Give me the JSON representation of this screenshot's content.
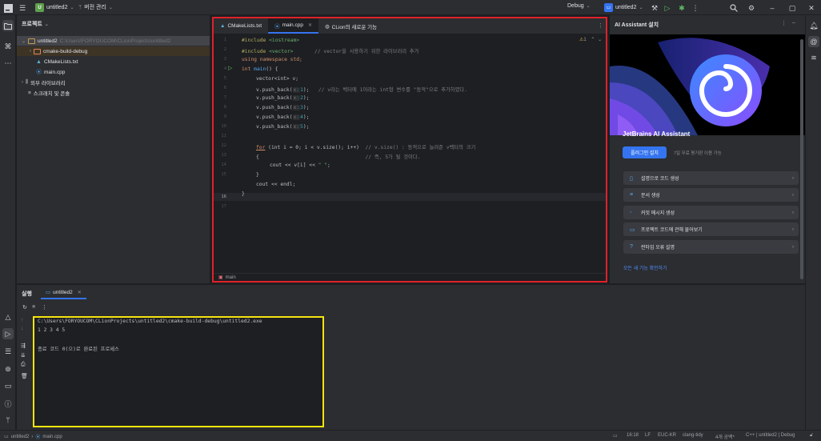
{
  "titlebar": {
    "project": "untitled2",
    "project_badge": "U",
    "vcs": "버전 관리",
    "config": "Debug",
    "run_target": "untitled2"
  },
  "project_panel": {
    "title": "프로젝트",
    "root": "untitled2",
    "root_path": "C:\\Users\\FORYOUCOM\\CLionProjects\\untitled2",
    "items": [
      {
        "label": "cmake-build-debug"
      },
      {
        "label": "CMakeLists.txt"
      },
      {
        "label": "main.cpp"
      }
    ],
    "external_libs": "외부 라이브러리",
    "scratches": "스크래치 및 콘솔"
  },
  "editor": {
    "tabs": [
      {
        "label": "CMakeLists.txt"
      },
      {
        "label": "main.cpp"
      },
      {
        "label": "CLion의 새로운 기능"
      }
    ],
    "warning_count": "1",
    "code": {
      "l1_directive": "#include",
      "l1_header": "<iostream>",
      "l2_directive": "#include",
      "l2_header": "<vector>",
      "l2_comment": "// vector을 사용하기 위한 라이브러리 추가",
      "l3": "using namespace std;",
      "l4_type": "int",
      "l4_fn": "main",
      "l4_rest": "() {",
      "l5": "vector<int> v;",
      "l6_pre": "v.push_back(",
      "l6_hint": "x:",
      "l6_num": "1",
      "l6_post": ");",
      "l6_comment": "// v라는 벡터에 1이라는 int형 변수를 \"동적\"으로 추가하였다.",
      "l7_pre": "v.push_back(",
      "l7_hint": "x:",
      "l7_num": "2",
      "l7_post": ");",
      "l8_pre": "v.push_back(",
      "l8_hint": "x:",
      "l8_num": "3",
      "l8_post": ");",
      "l9_pre": "v.push_back(",
      "l9_hint": "x:",
      "l9_num": "4",
      "l9_post": ");",
      "l10_pre": "v.push_back(",
      "l10_hint": "x:",
      "l10_num": "5",
      "l10_post": ");",
      "l12_kw": "for",
      "l12_rest": "(int i = 0; i < v.size(); i++)",
      "l12_comment": "// v.size() : 동적으로 늘려준 v벡터의 크기",
      "l13_code": "{",
      "l13_comment": "// 즉, 5가 될 것이다.",
      "l14_pre": "cout << v[i] << ",
      "l14_str": "\" \"",
      "l14_post": ";",
      "l15": "}",
      "l16": "cout << endl;",
      "l17": "}"
    },
    "line_numbers": [
      "1",
      "2",
      "3",
      "4",
      "5",
      "6",
      "7",
      "8",
      "9",
      "10",
      "11",
      "12",
      "13",
      "14",
      "15",
      "16",
      "17"
    ],
    "breadcrumb": "main"
  },
  "ai_panel": {
    "title": "AI Assistant 설치",
    "product": "JetBrains AI Assistant",
    "install_button": "플러그인 설치",
    "trial_text": "7일 무료 평가판 이용 가능",
    "features": [
      {
        "icon": "code-icon",
        "label": "설명으로 코드 생성"
      },
      {
        "icon": "doc-icon",
        "label": "문서 생성"
      },
      {
        "icon": "commit-icon",
        "label": "커밋 메시지 생성"
      },
      {
        "icon": "chat-icon",
        "label": "프로젝트 코드에 관해 물어보기"
      },
      {
        "icon": "help-icon",
        "label": "런타임 오류 설명"
      }
    ],
    "all_features_link": "모든 새 기능 확인하기"
  },
  "run_panel": {
    "title": "실행",
    "tab": "untitled2",
    "console": [
      "C:\\Users\\FORYOUCOM\\CLionProjects\\untitled2\\cmake-build-debug\\untitled2.exe",
      "1 2 3 4 5",
      "",
      "종료 코드 0(으)로 완료된 프로세스"
    ]
  },
  "statusbar": {
    "project": "untitled2",
    "file": "main.cpp",
    "position": "16:18",
    "line_sep": "LF",
    "encoding": "EUC-KR",
    "formatter": "clang-tidy",
    "indent": "4개 공백*",
    "context": "C++ | untitled2 | Debug"
  },
  "colors": {
    "editor_highlight_border": "#e0212a",
    "console_highlight_border": "#f5e50f",
    "accent": "#3574f0"
  }
}
